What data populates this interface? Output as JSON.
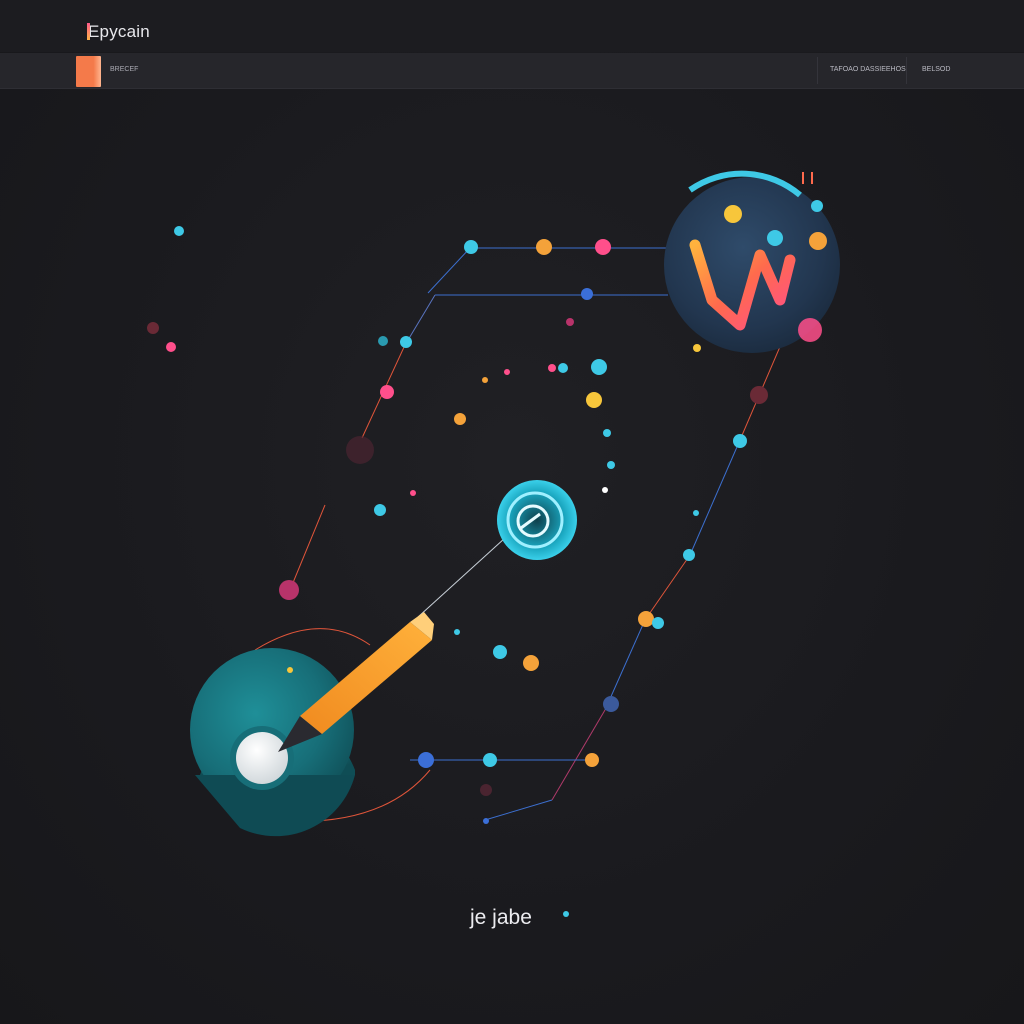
{
  "header": {
    "app_title": "Epycain"
  },
  "toolbar": {
    "label": "BRECEF",
    "menu": [
      {
        "label": "TAFOAO DASSIEEHOS"
      },
      {
        "label": "BELSOD"
      }
    ]
  },
  "illustration": {
    "caption": "je jabe",
    "icons": [
      "pencil-icon",
      "target-icon",
      "logo-badge-icon"
    ],
    "colors": {
      "background": "#1b1b1f",
      "teal": "#3ec9e6",
      "orange": "#f4a23a",
      "pink": "#ff4f8b",
      "yellow": "#f7c63b",
      "blue": "#3b6fd8",
      "accent": "#f47a4a"
    }
  }
}
